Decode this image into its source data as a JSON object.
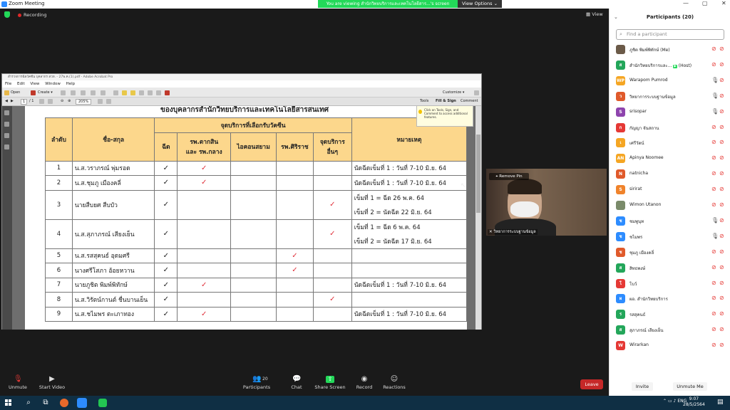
{
  "window": {
    "title": "Zoom Meeting",
    "share_banner": "You are viewing สำนักวิทยบริการและเทคโนโลยีสาร...'s screen",
    "view_options": "View Options ⌄",
    "recording": "Recording",
    "view_button": "View"
  },
  "acrobat": {
    "title": "สำรวจการฉีดวัคซีน บุคลากร สวท. - 27พ.ค.(1).pdf - Adobe Acrobat Pro",
    "menu": [
      "File",
      "Edit",
      "View",
      "Window",
      "Help"
    ],
    "open": "Open",
    "create": "Create ▾",
    "customize": "Customize ▾",
    "page_current": "1",
    "page_total": "/ 1",
    "zoom": "205%",
    "tools": "Tools",
    "fill_sign": "Fill & Sign",
    "comment": "Comment",
    "tooltip": "Click on Tools, Sign, and Comment to access additional features.",
    "doc_heading": "ของบุคลากรสำนักวิทยบริการและเทคโนโลยีสารสนเทศ"
  },
  "table": {
    "headers": {
      "no": "ลำดับ",
      "name": "ชื่อ-สกุล",
      "group": "จุดบริการที่เลือกรับวัคซีน",
      "c1": "ฉีด",
      "c2a": "รพ.ตากสิน",
      "c2b": "และ รพ.กลาง",
      "c3": "ไอคอนสยาม",
      "c4": "รพ.ศิริราช",
      "c5a": "จุดบริการ",
      "c5b": "อื่นๆ",
      "remark": "หมายเหตุ"
    },
    "rows": [
      {
        "no": "1",
        "name": "น.ส.วราภรณ์ พุ่มรอด",
        "remark1": "นัดฉีดเข็มที่ 1 : วันที่ 7-10 มิ.ย. 64",
        "remark2": ""
      },
      {
        "no": "2",
        "name": "น.ส.ชุมภู เมืองคลี่",
        "remark1": "นัดฉีดเข็มที่ 1 : วันที่ 7-10 มิ.ย. 64",
        "remark2": ""
      },
      {
        "no": "3",
        "name": "นายสืบยศ สืบบัว",
        "remark1": "เข็มที่ 1 = ฉีด 26 พ.ค. 64",
        "remark2": "เข็มที่ 2 = นัดฉีด 22 มิ.ย. 64"
      },
      {
        "no": "4",
        "name": "น.ส.สุภาภรณ์ เสียงเย็น",
        "remark1": "เข็มที่ 1 = ฉีด 6 พ.ค. 64",
        "remark2": "เข็มที่ 2 = นัดฉีด 17 มิ.ย. 64"
      },
      {
        "no": "5",
        "name": "น.ส.รสสุคนธ์ อุดมศรี",
        "remark1": "",
        "remark2": ""
      },
      {
        "no": "6",
        "name": "นางศรีโสภา อ้อยหวาน",
        "remark1": "",
        "remark2": ""
      },
      {
        "no": "7",
        "name": "นายภูชิต พิมพ์พิทักษ์",
        "remark1": "นัดฉีดเข็มที่ 1 : วันที่ 7-10 มิ.ย. 64",
        "remark2": ""
      },
      {
        "no": "8",
        "name": "น.ส.วิรัตน์กานต์ ชื่นบานเย็น",
        "remark1": "",
        "remark2": ""
      },
      {
        "no": "9",
        "name": "น.ส.ชไมพร ตะเภาทอง",
        "remark1": "นัดฉีดเข็มที่ 1 : วันที่ 7-10 มิ.ย. 64",
        "remark2": ""
      }
    ]
  },
  "video": {
    "remove_pin": "Remove Pin",
    "name": "วิทยาการระบบฐานข้อมูล"
  },
  "toolbar": {
    "unmute": "Unmute",
    "start_video": "Start Video",
    "participants": "Participants",
    "participants_count": "20",
    "chat": "Chat",
    "share_screen": "Share Screen",
    "record": "Record",
    "reactions": "Reactions",
    "leave": "Leave"
  },
  "panel": {
    "title": "Participants (20)",
    "search_placeholder": "Find a participant",
    "participants": [
      {
        "initial": "",
        "name": "ภูชิต พิมพ์พิทักษ์ (Me)",
        "color": "#6b5a48"
      },
      {
        "initial": "ส",
        "name": "สำนักวิทยบริการและ...",
        "host": "(Host)",
        "color": "#23a65a"
      },
      {
        "initial": "WP",
        "name": "Warapom Pumrod",
        "color": "#f5a623"
      },
      {
        "initial": "ว",
        "name": "วิทยาการระบบฐานข้อมูล",
        "color": "#e05a2b"
      },
      {
        "initial": "S",
        "name": "srisopar",
        "color": "#8e44ad"
      },
      {
        "initial": "ก",
        "name": "กัญญา จันสถาน",
        "color": "#e53935"
      },
      {
        "initial": "เ",
        "name": "เศรีวัตน์",
        "color": "#f5a623"
      },
      {
        "initial": "AN",
        "name": "Apinya Noomee",
        "color": "#f5a623"
      },
      {
        "initial": "N",
        "name": "natnicha",
        "color": "#e05a2b"
      },
      {
        "initial": "S",
        "name": "sirirat",
        "color": "#f0832b"
      },
      {
        "initial": "",
        "name": "Wimon Utanon",
        "color": "#7a8b6a"
      },
      {
        "initial": "ช",
        "name": "ชมพูนุท",
        "color": "#2d8cff"
      },
      {
        "initial": "ช",
        "name": "ชไมพร",
        "color": "#2d8cff"
      },
      {
        "initial": "ช",
        "name": "ชุมภู เมืองคลี่",
        "color": "#e05a2b"
      },
      {
        "initial": "ส",
        "name": "สิทธพงษ์",
        "color": "#23a65a"
      },
      {
        "initial": "โ",
        "name": "โบว์",
        "color": "#e53935"
      },
      {
        "initial": "ผ",
        "name": "ผอ. สำนักวิทยบริการ",
        "color": "#2d8cff"
      },
      {
        "initial": "ร",
        "name": "รสสุคนธ์",
        "color": "#23a65a"
      },
      {
        "initial": "ส",
        "name": "สุภาภรณ์ เสียงเย็น",
        "color": "#23a65a"
      },
      {
        "initial": "W",
        "name": "Wirarkan",
        "color": "#e53935"
      }
    ],
    "invite": "Invite",
    "unmute_me": "Unmute Me"
  },
  "taskbar": {
    "language": "ENG",
    "time": "9:07",
    "date": "28/5/2564"
  },
  "colors": {
    "accent": "#2d8cff",
    "share_green": "#23d959",
    "leave_red": "#c62828",
    "header_fill": "#fcd78c",
    "check_red": "#e0303a"
  }
}
